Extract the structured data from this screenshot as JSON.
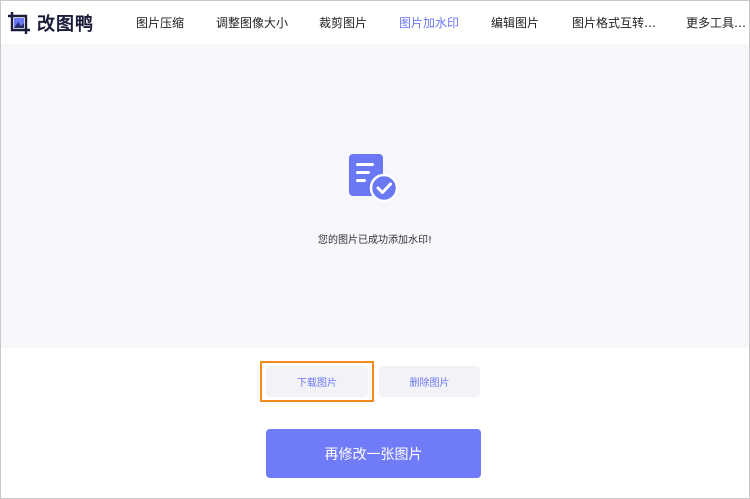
{
  "app": {
    "name": "改图鸭"
  },
  "nav": {
    "items": [
      {
        "label": "图片压缩"
      },
      {
        "label": "调整图像大小"
      },
      {
        "label": "裁剪图片"
      },
      {
        "label": "图片加水印",
        "active": true
      },
      {
        "label": "编辑图片"
      },
      {
        "label": "图片格式互转…"
      },
      {
        "label": "更多工具…"
      }
    ]
  },
  "main": {
    "success_message": "您的图片已成功添加水印!"
  },
  "actions": {
    "download_label": "下载图片",
    "delete_label": "删除图片",
    "edit_another_label": "再修改一张图片"
  },
  "colors": {
    "accent": "#6b78f4",
    "highlight": "#f28a1c",
    "panel": "#f6f6fb"
  },
  "icons": {
    "logo": "image-crop-logo-icon",
    "status": "document-check-icon"
  }
}
